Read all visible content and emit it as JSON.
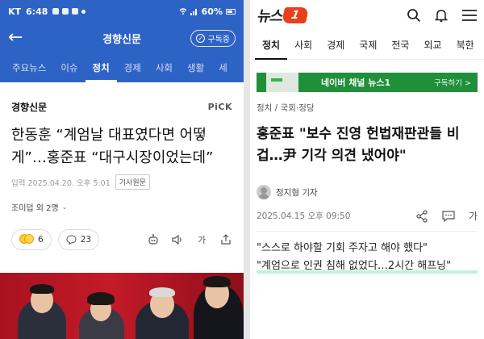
{
  "left": {
    "status": {
      "carrier": "KT",
      "time": "6:48",
      "battery": "60%"
    },
    "appbar": {
      "title": "경향신문",
      "subscribe_label": "구독중"
    },
    "categories": [
      "주요뉴스",
      "이슈",
      "정치",
      "경제",
      "사회",
      "생활",
      "세"
    ],
    "active_category": "정치",
    "publisher": "경향신문",
    "pick_label": "PiCK",
    "headline": "한동훈 “계엄날 대표였다면 어떻게”…홍준표 “대구시장이었는데”",
    "date": "입력 2025.04.20. 오후 5:01",
    "origin_label": "기사원문",
    "author": "조미덥 외 2명",
    "reactions": {
      "emoji_count": "6",
      "comment_count": "23"
    },
    "font_size_label": "가"
  },
  "right": {
    "logo": {
      "text": "뉴스",
      "badge": "1"
    },
    "categories": [
      "정치",
      "사회",
      "경제",
      "국제",
      "전국",
      "외교",
      "북한"
    ],
    "active_category": "정치",
    "banner": {
      "text": "네이버 채널 뉴스1",
      "cta": "구독하기 >"
    },
    "breadcrumb": "정치 / 국회·정당",
    "headline": "홍준표 \"보수 진영 헌법재판관들 비겁…尹 기각 의견 냈어야\"",
    "author": "정지형 기자",
    "date": "2025.04.15 오후 09:50",
    "font_size_label": "가",
    "quote_line1": "\"스스로 하야할 기회 주자고 해야 했다\"",
    "quote_line2": "\"계엄으로 인권 침해 없었다…2시간 해프닝\""
  },
  "colors": {
    "left_brand": "#2e63c6",
    "news1_accent": "#e8401c",
    "naver_green": "#1f8f3a",
    "highlight": "#bff2d8"
  }
}
